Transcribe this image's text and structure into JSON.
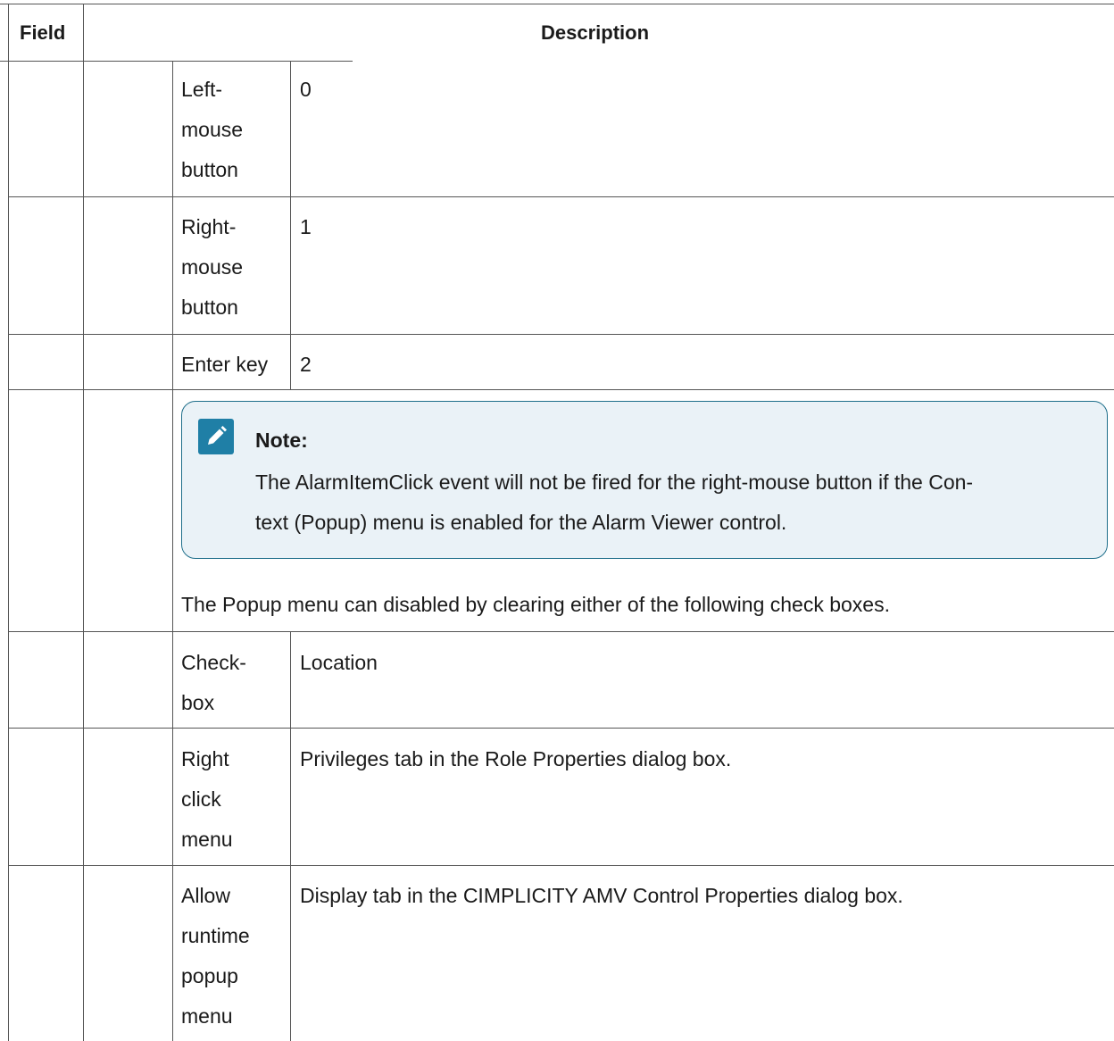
{
  "header": {
    "field": "Field",
    "description": "Description"
  },
  "rows": [
    {
      "label_lines": [
        "Left-",
        "mouse",
        "button"
      ],
      "value": "0"
    },
    {
      "label_lines": [
        "Right-",
        "mouse",
        "button"
      ],
      "value": "1"
    },
    {
      "label_lines": [
        "Enter key"
      ],
      "value": "2"
    }
  ],
  "note": {
    "title": "Note:",
    "body_lines": [
      "The AlarmItemClick event will not be fired for the right-mouse button if the Con-",
      "text (Popup) menu is enabled for the Alarm Viewer control."
    ],
    "icon": "edit-pencil-icon"
  },
  "popup_text": "The Popup menu can disabled by clearing either of the following check boxes.",
  "checkbox_rows": [
    {
      "label_lines": [
        "Check-",
        "box"
      ],
      "value": "Location"
    },
    {
      "label_lines": [
        "Right",
        "click",
        "menu"
      ],
      "value": "Privileges tab in the Role Properties dialog box."
    },
    {
      "label_lines": [
        "Allow",
        "runtime",
        "popup",
        "menu"
      ],
      "value": "Display tab in the CIMPLICITY AMV Control Properties dialog box."
    }
  ],
  "colors": {
    "note_bg": "#eaf2f7",
    "note_border": "#1f6f8b",
    "note_icon": "#1f7fa6"
  }
}
